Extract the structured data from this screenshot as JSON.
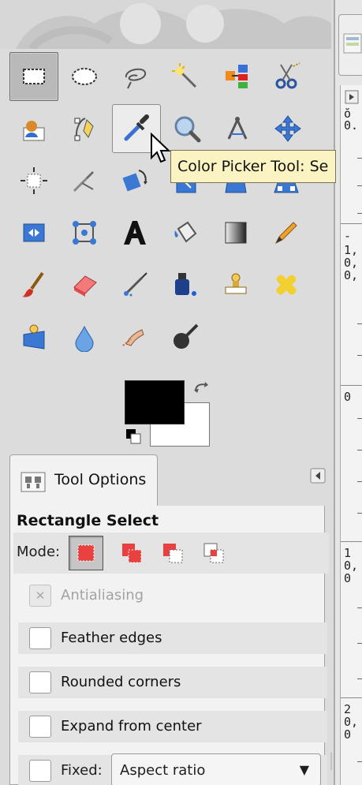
{
  "tooltip": "Color Picker Tool: Se",
  "tool_options_tab": {
    "label": "Tool Options"
  },
  "options": {
    "title": "Rectangle Select",
    "mode_label": "Mode:",
    "antialiasing": "Antialiasing",
    "feather_edges": "Feather edges",
    "rounded_corners": "Rounded corners",
    "expand_from_center": "Expand from center",
    "fixed_label": "Fixed:",
    "fixed_value": "Aspect ratio"
  },
  "right_panel": {
    "ruler_text": [
      "ŏ",
      "0.",
      "-",
      "1,",
      "0,",
      "0,",
      "0",
      "1",
      "0,",
      "0",
      "2",
      "0,",
      "0"
    ]
  },
  "colors": {
    "foreground": "#000000",
    "background": "#ffffff",
    "tooltip_bg": "#fbf3c1"
  }
}
